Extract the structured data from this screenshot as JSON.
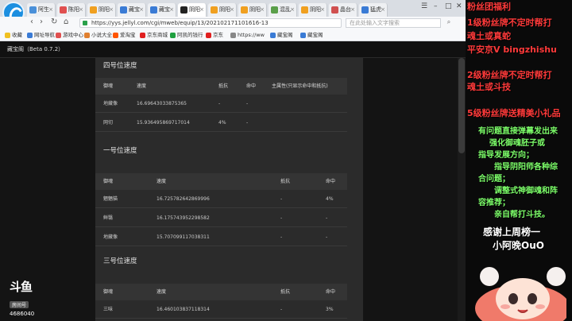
{
  "browser": {
    "tabs": [
      {
        "label": "阿生",
        "color": "#4a90d9"
      },
      {
        "label": "陈阳",
        "color": "#e05050"
      },
      {
        "label": "阴阳",
        "color": "#f0a020"
      },
      {
        "label": "藏宝",
        "color": "#3a7bd5"
      },
      {
        "label": "藏宝",
        "color": "#3a7bd5"
      },
      {
        "label": "阴阳",
        "color": "#222222"
      },
      {
        "label": "阴阳",
        "color": "#f0a020"
      },
      {
        "label": "阴阳",
        "color": "#f0a020"
      },
      {
        "label": "混乱",
        "color": "#5a9f4a"
      },
      {
        "label": "阴阳",
        "color": "#f0a020"
      },
      {
        "label": "晶台",
        "color": "#d05050"
      },
      {
        "label": "猛虎",
        "color": "#3a7bd5"
      }
    ],
    "address": "https://yys.jellyl.com/cgi/mweb/equip/13/202102171101616-13",
    "search_placeholder": "在此处输入文字搜索",
    "bookmarks": [
      {
        "label": "收藏",
        "color": "#f0c020"
      },
      {
        "label": "网址导航",
        "color": "#3a7bd5"
      },
      {
        "label": "游戏中心",
        "color": "#e05050"
      },
      {
        "label": "小说大全",
        "color": "#e08030"
      },
      {
        "label": "爱淘宝",
        "color": "#ff5500"
      },
      {
        "label": "京东商城",
        "color": "#e02020"
      },
      {
        "label": "阿凯的钱行",
        "color": "#20a040"
      },
      {
        "label": "京东",
        "color": "#e02020"
      },
      {
        "label": "https://ww",
        "color": "#888888"
      },
      {
        "label": "藏宝阁",
        "color": "#3a7bd5"
      },
      {
        "label": "藏宝阁",
        "color": "#3a7bd5"
      }
    ]
  },
  "app": {
    "title": "藏宝阁（Beta 0.7.2）"
  },
  "sections": [
    {
      "title": "四号位速度",
      "headers": [
        "御魂",
        "速度",
        "抵抗",
        "命中",
        "主属性(只显示命中和抵抗)"
      ],
      "rows": [
        [
          "地藏像",
          "16.69643033875365",
          "-",
          "-",
          ""
        ],
        [
          "网切",
          "15.936495869717014",
          "4%",
          "-",
          ""
        ]
      ]
    },
    {
      "title": "一号位速度",
      "headers": [
        "御魂",
        "速度",
        "抵抗",
        "命中"
      ],
      "rows": [
        [
          "魍魉猫",
          "16.725782642869996",
          "-",
          "4%"
        ],
        [
          "鲜翳",
          "16.175743952298582",
          "-",
          "-"
        ],
        [
          "地藏像",
          "15.707099117038311",
          "-",
          "-"
        ]
      ]
    },
    {
      "title": "三号位速度",
      "headers": [
        "御魂",
        "速度",
        "抵抗",
        "命中"
      ],
      "rows": [
        [
          "三味",
          "16.460103837118314",
          "-",
          "3%"
        ]
      ]
    }
  ],
  "douyu": {
    "logo": "斗鱼",
    "sub": "房间号",
    "room_id": "4686040"
  },
  "overlay": {
    "lines": [
      "粉丝团福利",
      "1级粉丝牌不定时帮打",
      "魂土或真蛇",
      "平安京V  bingzhishu",
      "2级粉丝牌不定时帮打",
      "魂土或斗技",
      "5级粉丝牌送精美小礼品",
      "有问题直接弹幕发出来",
      "强化御魂胚子或",
      "指导发展方向；",
      "指导阴阳师各种综",
      "合问题；",
      "调整式神御魂和阵",
      "容推荐；",
      "亲自帮打斗技。",
      "感谢上周榜一",
      "小阿晚OuO"
    ]
  }
}
